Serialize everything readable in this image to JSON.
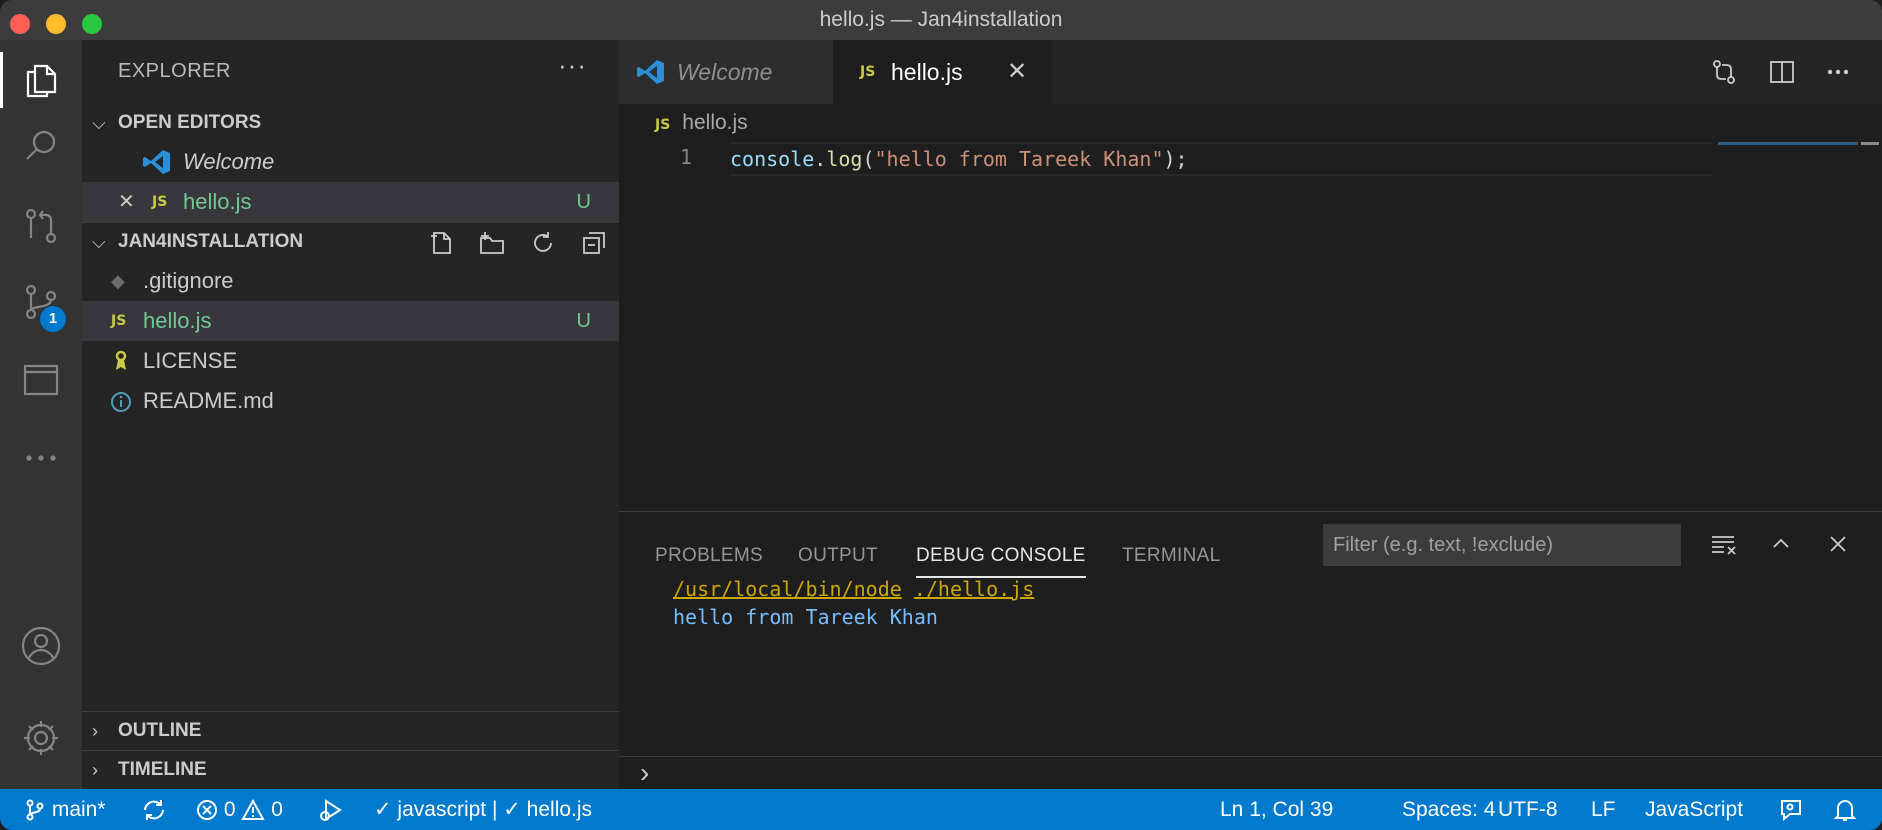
{
  "window": {
    "title": "hello.js — Jan4installation"
  },
  "activity_bar": {
    "source_control_badge": "1"
  },
  "sidebar": {
    "title": "EXPLORER",
    "more": "···",
    "open_editors": {
      "label": "OPEN EDITORS",
      "items": [
        {
          "name": "Welcome"
        },
        {
          "name": "hello.js",
          "status": "U",
          "close": "✕",
          "icon": "JS"
        }
      ]
    },
    "workspace": {
      "label": "JAN4INSTALLATION",
      "files": [
        {
          "name": ".gitignore"
        },
        {
          "name": "hello.js",
          "status": "U",
          "icon": "JS"
        },
        {
          "name": "LICENSE"
        },
        {
          "name": "README.md"
        }
      ]
    },
    "outline": {
      "label": "OUTLINE"
    },
    "timeline": {
      "label": "TIMELINE"
    }
  },
  "tabs": [
    {
      "label": "Welcome"
    },
    {
      "label": "hello.js",
      "icon": "JS",
      "close": "✕"
    }
  ],
  "editor": {
    "breadcrumb": "hello.js",
    "breadcrumb_icon": "JS",
    "line_number": "1",
    "code": {
      "obj": "console",
      "dot": ".",
      "fn": "log",
      "open": "(",
      "str": "\"hello from Tareek Khan\"",
      "close": ");"
    }
  },
  "panel": {
    "tabs": [
      "PROBLEMS",
      "OUTPUT",
      "DEBUG CONSOLE",
      "TERMINAL"
    ],
    "filter_placeholder": "Filter (e.g. text, !exclude)",
    "console": {
      "node_path": "/usr/local/bin/node",
      "script": "./hello.js",
      "output": "hello from Tareek Khan"
    },
    "prompt": "›"
  },
  "status_bar": {
    "branch": "main*",
    "errors": "0",
    "warnings": "0",
    "checks": "✓ javascript | ✓ hello.js",
    "position": "Ln 1, Col 39",
    "spaces": "Spaces: 4",
    "encoding": "UTF-8",
    "eol": "LF",
    "language": "JavaScript"
  },
  "colors": {
    "accent": "#007acc",
    "untracked": "#73c991",
    "js_icon": "#cbcb41",
    "string": "#ce9178",
    "function": "#dcdcaa",
    "variable": "#9cdcfe"
  }
}
